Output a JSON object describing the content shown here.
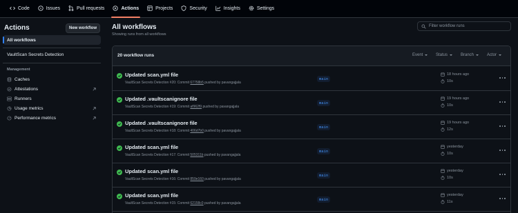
{
  "topnav": [
    {
      "label": "Code",
      "icon": "code-icon",
      "active": false
    },
    {
      "label": "Issues",
      "icon": "issue-icon",
      "active": false
    },
    {
      "label": "Pull requests",
      "icon": "pull-request-icon",
      "active": false
    },
    {
      "label": "Actions",
      "icon": "play-icon",
      "active": true
    },
    {
      "label": "Projects",
      "icon": "table-icon",
      "active": false
    },
    {
      "label": "Security",
      "icon": "shield-icon",
      "active": false
    },
    {
      "label": "Insights",
      "icon": "graph-icon",
      "active": false
    },
    {
      "label": "Settings",
      "icon": "gear-icon",
      "active": false
    }
  ],
  "sidebar": {
    "title": "Actions",
    "new_workflow": "New workflow",
    "all_workflows": "All workflows",
    "workflow_item": "VaultScan Secrets Detection",
    "management_heading": "Management",
    "management": [
      {
        "label": "Caches",
        "icon": "database-icon",
        "external": false
      },
      {
        "label": "Attestations",
        "icon": "verified-icon",
        "external": true
      },
      {
        "label": "Runners",
        "icon": "server-icon",
        "external": false
      },
      {
        "label": "Usage metrics",
        "icon": "graph-icon",
        "external": true
      },
      {
        "label": "Performance metrics",
        "icon": "meter-icon",
        "external": true
      }
    ]
  },
  "main": {
    "title": "All workflows",
    "subtitle": "Showing runs from all workflows",
    "filter_placeholder": "Filter workflow runs",
    "runs_count": "20 workflow runs",
    "filters": [
      "Event",
      "Status",
      "Branch",
      "Actor"
    ]
  },
  "runs": [
    {
      "title": "Updated scan.yml file",
      "workflow": "VaultScan Secrets Detection #20: Commit",
      "sha": "67758b5",
      "pushed": "pushed by pavangajjala",
      "branch": "main",
      "when": "18 hours ago",
      "duration": "10s"
    },
    {
      "title": "Updated .vaultscanignore file",
      "workflow": "VaultScan Secrets Detection #19: Commit",
      "sha": "af962f9",
      "pushed": "pushed by pavangajjala",
      "branch": "main",
      "when": "19 hours ago",
      "duration": "10s"
    },
    {
      "title": "Updated .vaultscanignore file",
      "workflow": "VaultScan Secrets Detection #18: Commit",
      "sha": "406d7b0",
      "pushed": "pushed by pavangajjala",
      "branch": "main",
      "when": "19 hours ago",
      "duration": "12s"
    },
    {
      "title": "Updated scan.yml file",
      "workflow": "VaultScan Secrets Detection #17: Commit",
      "sha": "505311b",
      "pushed": "pushed by pavangajjala",
      "branch": "main",
      "when": "yesterday",
      "duration": "10s"
    },
    {
      "title": "Updated scan.yml file",
      "workflow": "VaultScan Secrets Detection #16: Commit",
      "sha": "859e160",
      "pushed": "pushed by pavangajjala",
      "branch": "main",
      "when": "yesterday",
      "duration": "10s"
    },
    {
      "title": "Updated scan.yml file",
      "workflow": "VaultScan Secrets Detection #15: Commit",
      "sha": "62158c0",
      "pushed": "pushed by pavangajjala",
      "branch": "main",
      "when": "yesterday",
      "duration": "11s"
    }
  ],
  "colors": {
    "accent": "#2f81f7",
    "success": "#3fb950",
    "tab_underline": "#f78166",
    "background": "#0d1117"
  }
}
